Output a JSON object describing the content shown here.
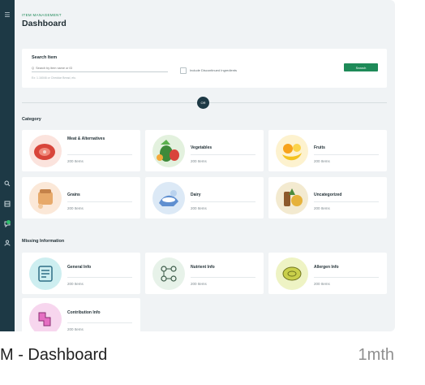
{
  "header": {
    "eyebrow": "ITEM MANAGEMENT",
    "title": "Dashboard"
  },
  "search": {
    "label": "Search Item",
    "placeholder": "Q  Search by item name or ID",
    "hint": "Ex: 1.16046 or Cheddar Bread, etc.",
    "discontinued_label": "Include Discontinued Ingredients",
    "button_label": "Search"
  },
  "toggle_label": "OR",
  "category": {
    "heading": "Category",
    "items": [
      {
        "name": "Meat & Alternatives",
        "count": "200 Items",
        "icon": "meat-icon"
      },
      {
        "name": "Vegetables",
        "count": "200 Items",
        "icon": "vegetables-icon"
      },
      {
        "name": "Fruits",
        "count": "200 Items",
        "icon": "fruits-icon"
      },
      {
        "name": "Grains",
        "count": "200 Items",
        "icon": "grains-icon"
      },
      {
        "name": "Dairy",
        "count": "200 Items",
        "icon": "dairy-icon"
      },
      {
        "name": "Uncategorized",
        "count": "200 Items",
        "icon": "uncategorized-icon"
      }
    ]
  },
  "missing": {
    "heading": "Missing Information",
    "items": [
      {
        "name": "General Info",
        "count": "200 Items",
        "icon": "general-info-icon"
      },
      {
        "name": "Nutrient Info",
        "count": "200 Items",
        "icon": "nutrient-info-icon"
      },
      {
        "name": "Allergen Info",
        "count": "200 Items",
        "icon": "allergen-info-icon"
      },
      {
        "name": "Contribution Info",
        "count": "200 Items",
        "icon": "contribution-info-icon"
      }
    ]
  },
  "rail": {
    "icons": [
      "menu-icon",
      "search-icon",
      "list-icon",
      "chat-icon",
      "user-icon"
    ]
  },
  "caption": {
    "title": "M - Dashboard",
    "time": "1mth"
  },
  "colors": {
    "brand_green": "#1e8a58",
    "sidebar": "#1d3945",
    "background": "#f0f3f5"
  }
}
